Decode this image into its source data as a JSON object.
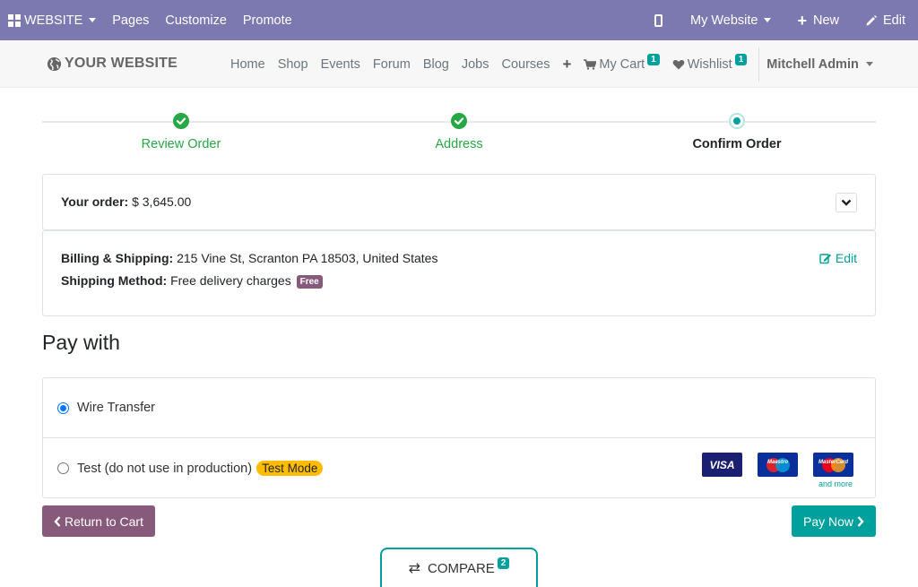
{
  "adminbar": {
    "website_label": "WEBSITE",
    "pages_label": "Pages",
    "customize_label": "Customize",
    "promote_label": "Promote",
    "mywebsite_label": "My Website",
    "new_label": "New",
    "edit_label": "Edit",
    "bg_color": "#7c78b0"
  },
  "header": {
    "logo_text": "YOUR WEBSITE",
    "nav": [
      "Home",
      "Shop",
      "Events",
      "Forum",
      "Blog",
      "Jobs",
      "Courses"
    ],
    "mycart_label": "My Cart",
    "mycart_count": "1",
    "wishlist_label": "Wishlist",
    "wishlist_count": "1",
    "user_name": "Mitchell Admin"
  },
  "wizard": {
    "steps": [
      {
        "label": "Review Order",
        "state": "done"
      },
      {
        "label": "Address",
        "state": "done"
      },
      {
        "label": "Confirm Order",
        "state": "current"
      }
    ]
  },
  "order": {
    "label": "Your order:",
    "amount": "$ 3,645.00"
  },
  "billing": {
    "billing_label": "Billing & Shipping:",
    "billing_value": "215 Vine St, Scranton PA 18503, United States",
    "shipping_label": "Shipping Method:",
    "shipping_value": "Free delivery charges",
    "shipping_badge": "Free",
    "edit_label": "Edit"
  },
  "payment": {
    "heading": "Pay with",
    "methods": [
      {
        "label": "Wire Transfer",
        "selected": true
      },
      {
        "label": "Test (do not use in production)",
        "selected": false,
        "badge": "Test Mode"
      }
    ],
    "card_logos": {
      "visa": "VISA",
      "maestro": "Maestro",
      "mastercard": "MasterCard"
    },
    "and_more": "and more"
  },
  "actions": {
    "return_label": "Return to Cart",
    "pay_label": "Pay Now"
  },
  "compare": {
    "label": "COMPARE",
    "count": "2"
  },
  "colors": {
    "primary": "#00a09d",
    "secondary": "#875a7b",
    "success": "#28a745",
    "warning": "#ffbc00"
  }
}
